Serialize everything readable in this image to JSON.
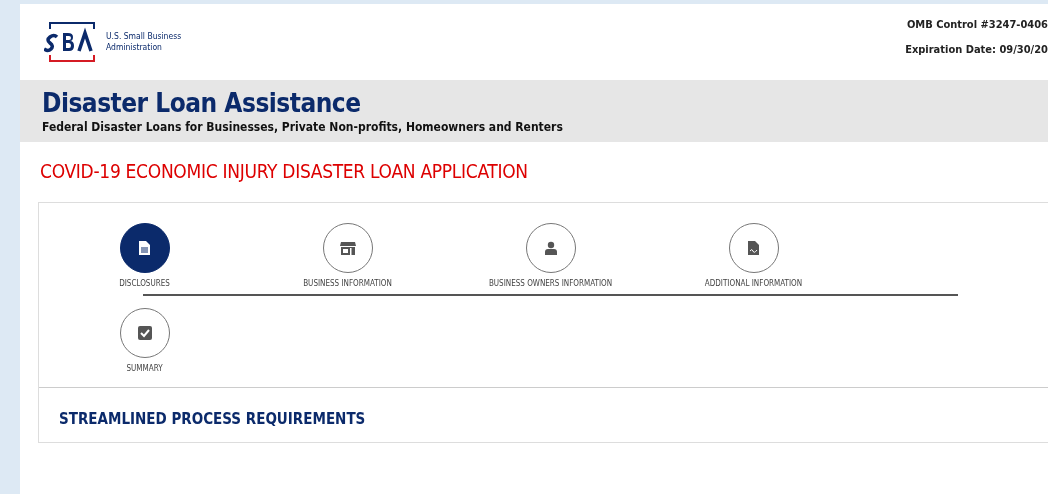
{
  "header": {
    "agency_line_1": "U.S. Small Business",
    "agency_line_2": "Administration",
    "omb_control": "OMB Control #3247-0406",
    "expiration": "Expiration Date: 09/30/20"
  },
  "banner": {
    "title": "Disaster Loan Assistance",
    "subtitle": "Federal Disaster Loans for Businesses, Private Non-profits, Homeowners and Renters"
  },
  "page_title": "COVID-19 ECONOMIC INJURY DISASTER LOAN APPLICATION",
  "steps": [
    {
      "label": "DISCLOSURES",
      "kind": "document",
      "selected": true
    },
    {
      "label": "BUSINESS INFORMATION",
      "kind": "store",
      "selected": false
    },
    {
      "label": "BUSINESS OWNERS INFORMATION",
      "kind": "person",
      "selected": false
    },
    {
      "label": "ADDITIONAL INFORMATION",
      "kind": "pdf",
      "selected": false
    },
    {
      "label": "SUMMARY",
      "kind": "check",
      "selected": false
    }
  ],
  "section_heading": "STREAMLINED PROCESS REQUIREMENTS"
}
